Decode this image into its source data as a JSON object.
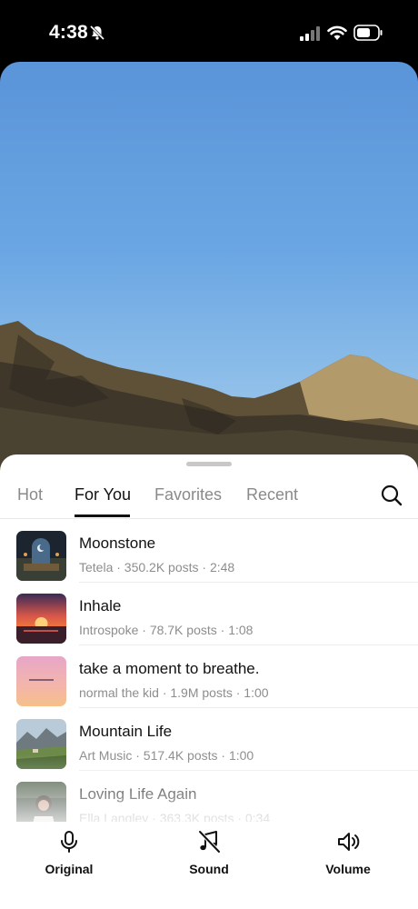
{
  "status_bar": {
    "time": "4:38"
  },
  "tabs": [
    {
      "label": "Hot",
      "active": false
    },
    {
      "label": "For You",
      "active": true
    },
    {
      "label": "Favorites",
      "active": false
    },
    {
      "label": "Recent",
      "active": false
    }
  ],
  "tracks": [
    {
      "title": "Moonstone",
      "meta": "Tetela · 350.2K posts · 2:48",
      "art": "moonstone-cover"
    },
    {
      "title": "Inhale",
      "meta": "Introspoke · 78.7K posts · 1:08",
      "art": "sunset-cover"
    },
    {
      "title": "take a moment to breathe.",
      "meta": "normal the kid · 1.9M posts · 1:00",
      "art": "pink-sky-cover"
    },
    {
      "title": "Mountain Life",
      "meta": "Art Music · 517.4K posts · 1:00",
      "art": "mountain-cover"
    },
    {
      "title": "Loving Life Again",
      "meta": "Ella Langley · 363.3K posts · 0:34",
      "art": "portrait-cover"
    }
  ],
  "toolbar": {
    "original_label": "Original",
    "sound_label": "Sound",
    "volume_label": "Volume"
  },
  "icons": {
    "search": "search-icon",
    "original": "microphone-icon",
    "sound": "music-note-slash-icon",
    "volume": "speaker-icon"
  }
}
